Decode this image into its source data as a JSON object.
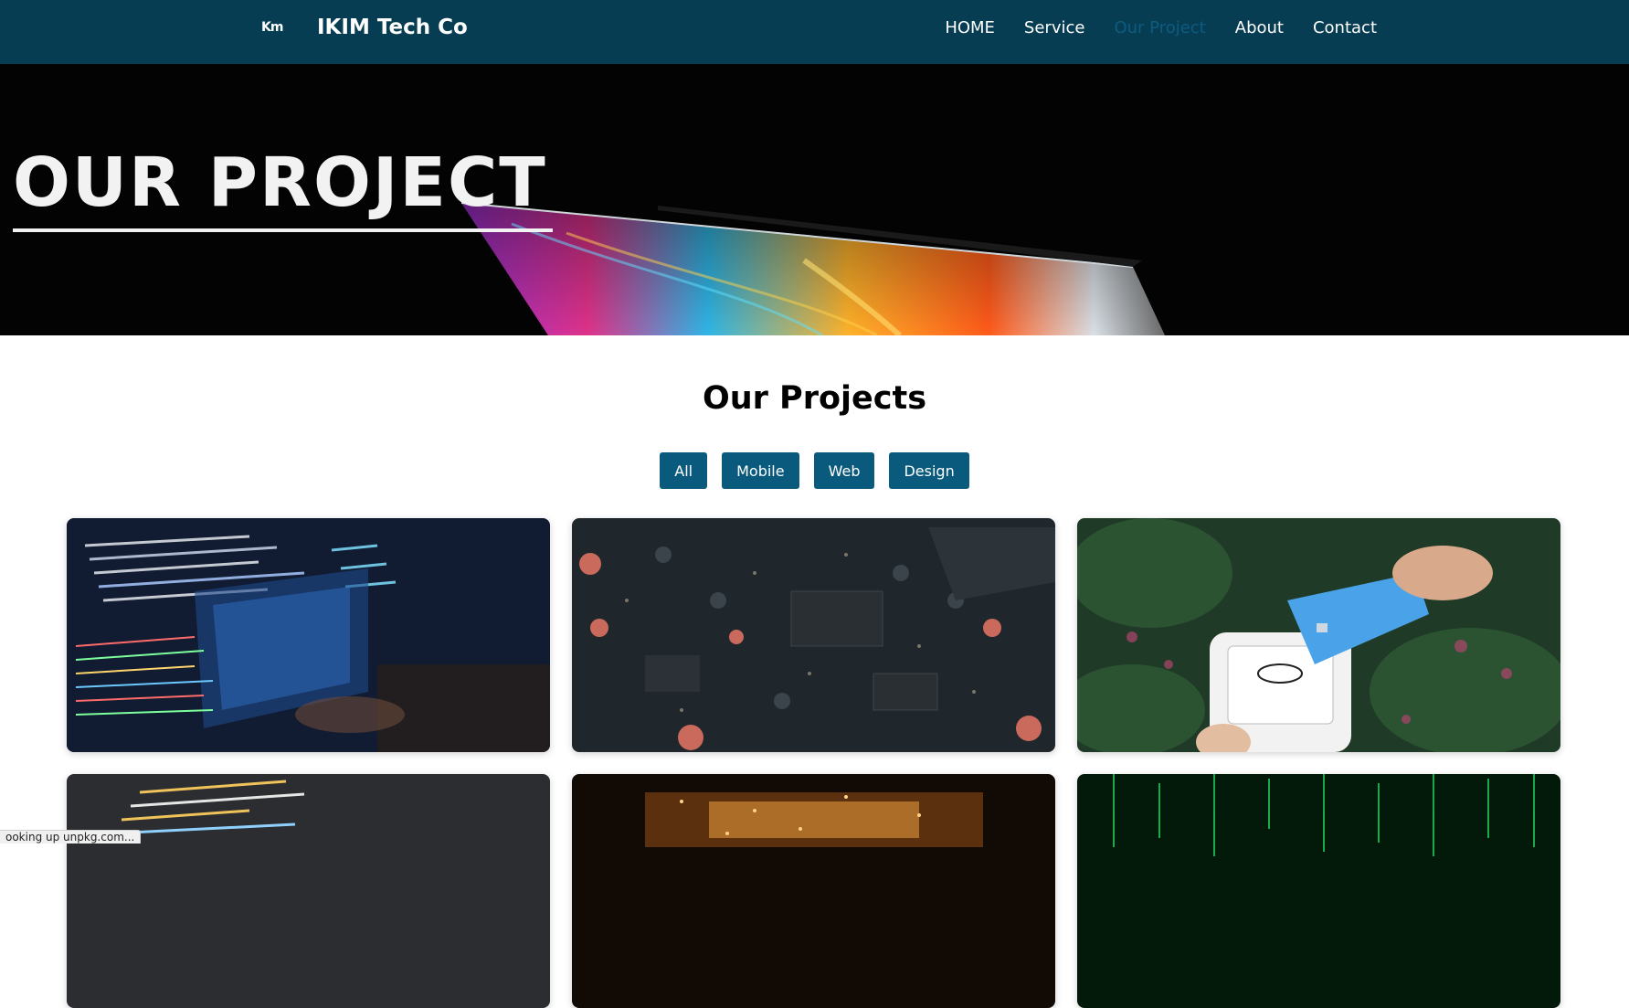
{
  "navbar": {
    "logo_text": "Km",
    "brand": "IKIM Tech Co",
    "links": [
      {
        "label": "HOME",
        "active": false
      },
      {
        "label": "Service",
        "active": false
      },
      {
        "label": "Our Project",
        "active": true
      },
      {
        "label": "About",
        "active": false
      },
      {
        "label": "Contact",
        "active": false
      }
    ]
  },
  "hero": {
    "title": "OUR PROJECT"
  },
  "projects": {
    "title": "Our Projects",
    "filters": [
      "All",
      "Mobile",
      "Web",
      "Design"
    ],
    "cards": [
      {
        "image": "code-screen-photo"
      },
      {
        "image": "circuit-board-photo"
      },
      {
        "image": "card-payment-terminal-photo"
      },
      {
        "image": "php-code-photo"
      },
      {
        "image": "light-tunnel-photo"
      },
      {
        "image": "matrix-code-photo"
      }
    ]
  },
  "status_bar": {
    "text": "ooking up unpkg.com..."
  },
  "colors": {
    "nav_background": "#073d52",
    "active_link": "#0d5c80",
    "button_background": "#0a5a7e",
    "hero_background": "#030303"
  }
}
